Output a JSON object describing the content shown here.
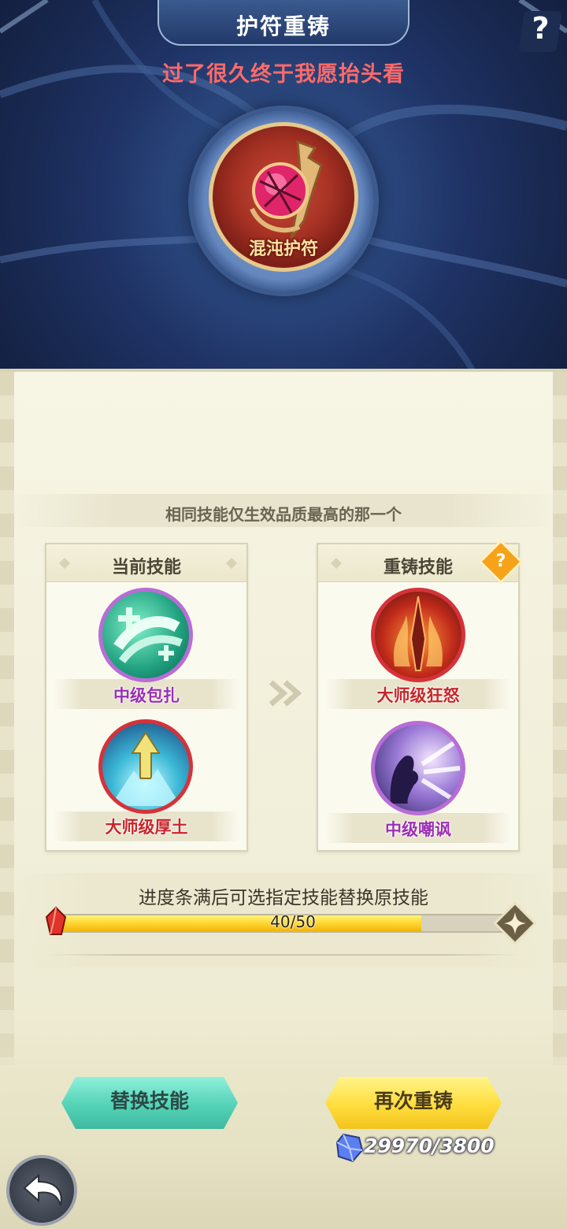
{
  "header": {
    "title": "护符重铸",
    "help_icon": "question-mark-icon",
    "help_label": "?",
    "subtitle": "过了很久终于我愿抬头看"
  },
  "amulet": {
    "name": "混沌护符",
    "icon": "chaos-amulet-icon"
  },
  "note": "相同技能仅生效品质最高的那一个",
  "current_skills": {
    "title": "当前技能",
    "items": [
      {
        "label": "中级包扎",
        "icon": "bandage-icon",
        "color": "#9b2fb3"
      },
      {
        "label": "大师级厚土",
        "icon": "earth-arrow-icon",
        "color": "#c8252a"
      }
    ]
  },
  "arrow_icon": "double-chevron-right-icon",
  "reforged_skills": {
    "title": "重铸技能",
    "help_label": "?",
    "items": [
      {
        "label": "大师级狂怒",
        "icon": "flame-blade-icon",
        "color": "#c8252a"
      },
      {
        "label": "中级嘲讽",
        "icon": "taunt-shout-icon",
        "color": "#9b2fb3"
      }
    ]
  },
  "progress": {
    "caption": "进度条满后可选指定技能替换原技能",
    "current": 40,
    "max": 50,
    "text": "40/50",
    "fill_fraction": 0.8
  },
  "buttons": {
    "replace_label": "替换技能",
    "reforge_label": "再次重铸"
  },
  "cost": {
    "icon": "crystal-icon",
    "text": "29970/3800"
  },
  "back_icon": "back-arrow-icon",
  "colors": {
    "accent_teal": "#54d2b6",
    "accent_yellow": "#ffdd3d",
    "subtitle_red": "#ff6a6a",
    "epic_purple": "#9b2fb3",
    "legend_red": "#c8252a"
  }
}
